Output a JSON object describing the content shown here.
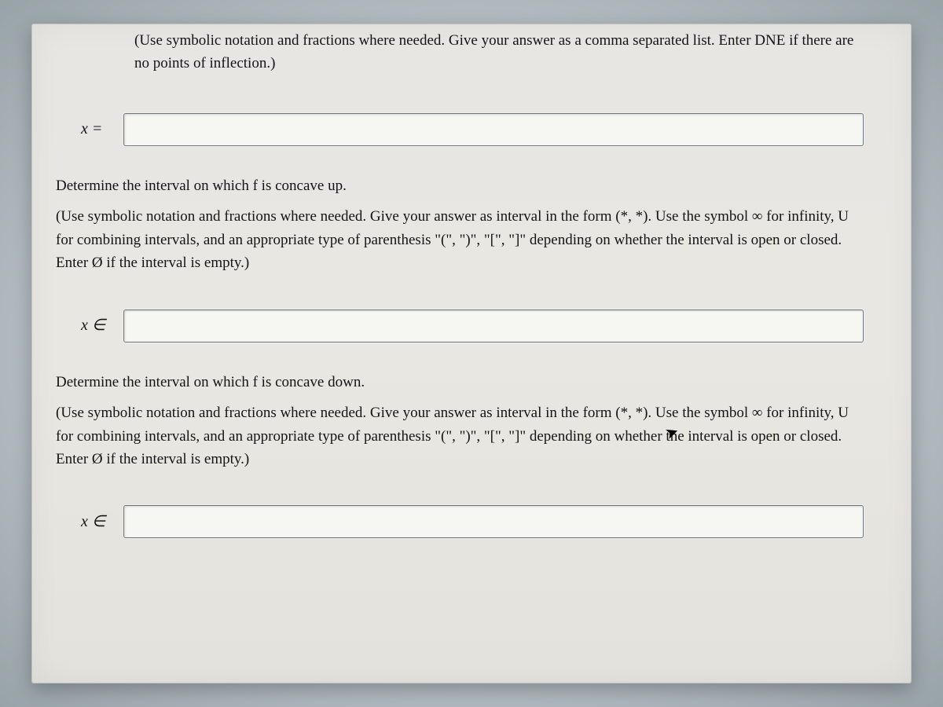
{
  "top": {
    "instruction": "(Use symbolic notation and fractions where needed. Give your answer as a comma separated list. Enter DNE if there are no points of inflection.)",
    "label": "x ="
  },
  "section_up": {
    "heading": "Determine the interval on which f is concave up.",
    "instruction": "(Use symbolic notation and fractions where needed. Give your answer as interval in the form (*, *). Use the symbol ∞ for infinity, U for combining intervals, and an appropriate type of parenthesis \"(\", \")\", \"[\", \"]\" depending on whether the interval is open or closed. Enter Ø if the interval is empty.)",
    "label": "x ∈"
  },
  "section_down": {
    "heading": "Determine the interval on which f is concave down.",
    "instruction": "(Use symbolic notation and fractions where needed. Give your answer as interval in the form (*, *). Use the symbol ∞ for infinity, U for combining intervals, and an appropriate type of parenthesis \"(\", \")\", \"[\", \"]\" depending on whether the interval is open or closed. Enter Ø if the interval is empty.)",
    "label": "x ∈"
  },
  "inputs": {
    "inflection": "",
    "concave_up": "",
    "concave_down": ""
  }
}
